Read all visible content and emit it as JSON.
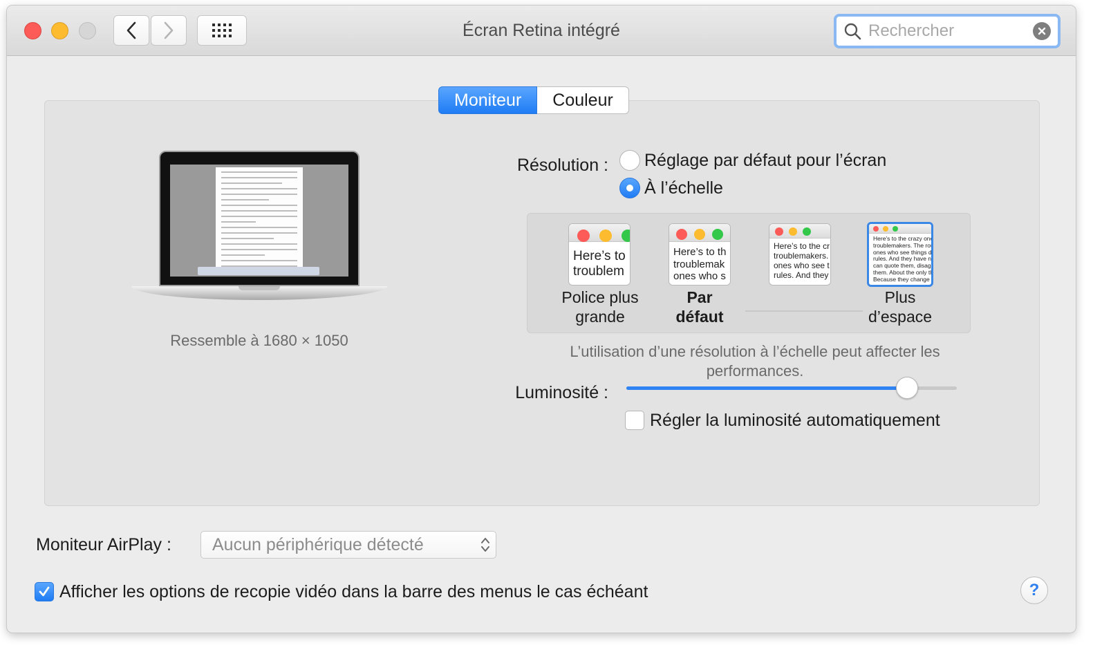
{
  "window": {
    "title": "Écran Retina intégré"
  },
  "toolbar": {
    "back_icon": "chevron-left-icon",
    "forward_icon": "chevron-right-icon",
    "grid_icon": "grid-icon",
    "search_placeholder": "Rechercher"
  },
  "tabs": [
    {
      "label": "Moniteur",
      "active": true
    },
    {
      "label": "Couleur",
      "active": false
    }
  ],
  "display": {
    "resemble_text": "Ressemble à 1680 × 1050",
    "resolution_label": "Résolution :",
    "resolution_options": [
      {
        "label": "Réglage par défaut pour l’écran",
        "selected": false
      },
      {
        "label": "À l’échelle",
        "selected": true
      }
    ],
    "scale_options": [
      {
        "caption_line1": "Police plus",
        "caption_line2": "grande",
        "preview": [
          "Here’s to",
          "troublem"
        ],
        "selected": false,
        "bold": false
      },
      {
        "caption_line1": "Par",
        "caption_line2": "défaut",
        "preview": [
          "Here’s to th",
          "troublemak",
          "ones who s"
        ],
        "selected": false,
        "bold": true
      },
      {
        "caption_line1": "",
        "caption_line2": "",
        "preview": [
          "Here’s to the cr",
          "troublemakers.",
          "ones who see t",
          "rules. And they"
        ],
        "selected": false,
        "bold": false
      },
      {
        "caption_line1": "Plus",
        "caption_line2": "d’espace",
        "preview": [
          "Here’s to the crazy one",
          "troublemakers. The rou",
          "ones who see things di",
          "rules. And they have no",
          "can quote them, disagr",
          "them. About the only th",
          "Because they change t"
        ],
        "selected": true,
        "bold": false
      }
    ],
    "scale_note_line1": "L’utilisation d’une résolution à l’échelle peut affecter les",
    "scale_note_line2": "performances.",
    "brightness_label": "Luminosité :",
    "brightness_level": 0.85,
    "auto_brightness_label": "Régler la luminosité automatiquement",
    "auto_brightness_checked": false
  },
  "airplay": {
    "label": "Moniteur AirPlay :",
    "selected_value": "Aucun périphérique détecté"
  },
  "mirroring": {
    "label": "Afficher les options de recopie vidéo dans la barre des menus le cas échéant",
    "checked": true
  },
  "help": {
    "label": "?"
  },
  "colors": {
    "accent": "#1f7cf4",
    "close": "#fc5b57",
    "minimize": "#fdbc2f",
    "zoom_disabled": "#d6d6d6"
  }
}
